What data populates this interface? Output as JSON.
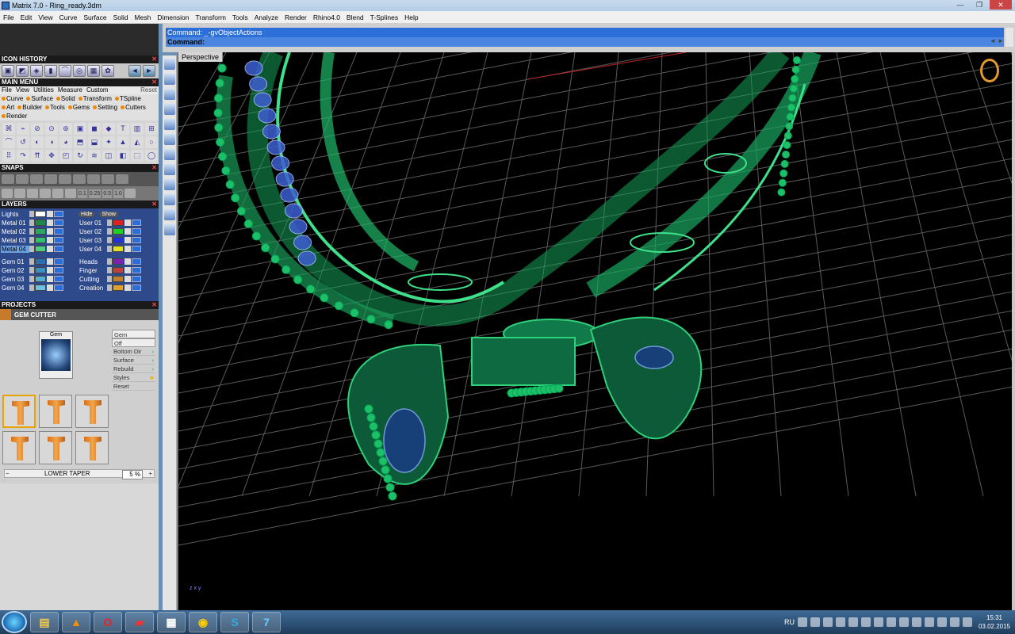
{
  "window": {
    "title": "Matrix 7.0 - Ring_ready.3dm",
    "minimize": "—",
    "restore": "❐",
    "close": "✕"
  },
  "menubar": [
    "File",
    "Edit",
    "View",
    "Curve",
    "Surface",
    "Solid",
    "Mesh",
    "Dimension",
    "Transform",
    "Tools",
    "Analyze",
    "Render",
    "Rhino4.0",
    "Blend",
    "T-Splines",
    "Help"
  ],
  "command": {
    "history_line": "Command: _-gvObjectActions",
    "prompt": "Command:",
    "nav_left": "◄",
    "nav_right": "►"
  },
  "panels": {
    "icon_history": "ICON HISTORY",
    "main_menu": "MAIN MENU",
    "main_menu_items": [
      "File",
      "View",
      "Utilities",
      "Measure",
      "Custom"
    ],
    "reset": "Reset",
    "main_tabs": [
      "Curve",
      "Surface",
      "Solid",
      "Transform",
      "TSpline",
      "Art",
      "Builder",
      "Tools",
      "Gems",
      "Setting",
      "Cutters",
      "Render"
    ],
    "snaps": "SNAPS",
    "snap_values": [
      "0.1",
      "0.25",
      "0.5",
      "1.0"
    ],
    "layers": "LAYERS",
    "hide": "Hide",
    "show": "Show",
    "projects": "PROJECTS",
    "gem_cutter": "GEM CUTTER",
    "gem_thumb_label": "Gem"
  },
  "layers": {
    "left": [
      {
        "name": "Lights",
        "color": "#ffffff",
        "selected": false
      },
      {
        "name": "Metal 01",
        "color": "#1e8a4a",
        "selected": false
      },
      {
        "name": "Metal 02",
        "color": "#2aa860",
        "selected": false
      },
      {
        "name": "Metal 03",
        "color": "#30c070",
        "selected": false
      },
      {
        "name": "Metal 04",
        "color": "#4ad080",
        "selected": true
      },
      {
        "name": "Gem 01",
        "color": "#2a70b0",
        "selected": false
      },
      {
        "name": "Gem 02",
        "color": "#3a90c0",
        "selected": false
      },
      {
        "name": "Gem 03",
        "color": "#55b0d0",
        "selected": false
      },
      {
        "name": "Gem 04",
        "color": "#70c0e0",
        "selected": false
      }
    ],
    "right": [
      {
        "name": "User 01",
        "color": "#e02020"
      },
      {
        "name": "User 02",
        "color": "#20d020"
      },
      {
        "name": "User 03",
        "color": "#2030e0"
      },
      {
        "name": "User 04",
        "color": "#e0e020"
      },
      {
        "name": "Heads",
        "color": "#8020b0"
      },
      {
        "name": "Finger",
        "color": "#c04040"
      },
      {
        "name": "Cutting",
        "color": "#c08030"
      },
      {
        "name": "Creation",
        "color": "#e0a030"
      }
    ]
  },
  "gem_options": [
    "Gem",
    "Off",
    "Bottom Dir",
    "Surface",
    "Rebuild",
    "Styles",
    "Reset"
  ],
  "lower_taper": {
    "label": "LOWER TAPER",
    "value": "5 %",
    "minus": "−",
    "plus": "+"
  },
  "viewport": {
    "label": "Perspective",
    "axis_z": "z",
    "axis_x": "x",
    "axis_y": "y"
  },
  "taskbar": {
    "lang": "RU",
    "time": "15:31",
    "date": "03.02.2015"
  },
  "colors": {
    "wire": "#29d07a",
    "grid": "#6a6a6a",
    "gem": "#6a90ff",
    "accent": "#2d6fd8"
  }
}
